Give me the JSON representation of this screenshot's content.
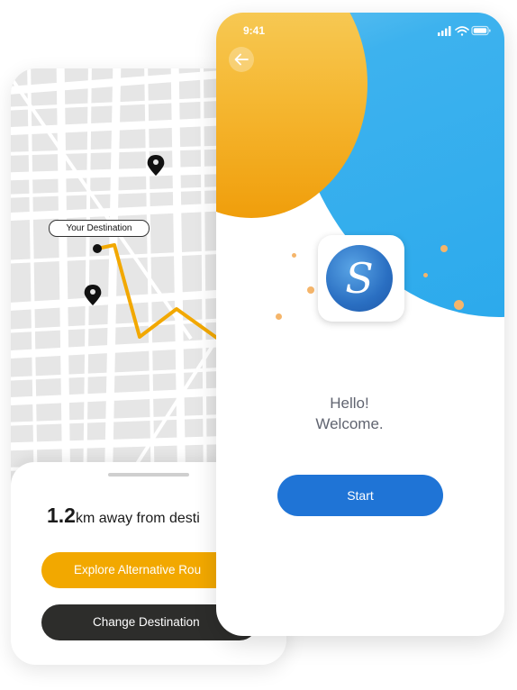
{
  "map_screen": {
    "destination_label": "Your Destination",
    "distance_value": "1.2",
    "distance_text": "km away from desti",
    "explore_button_label": "Explore Alternative Rou",
    "change_destination_label": "Change Destination",
    "route_color": "#f2a800",
    "pins": [
      "map-pin-icon",
      "map-pin-icon"
    ]
  },
  "welcome_screen": {
    "status_time": "9:41",
    "status_icons": [
      "signal-icon",
      "wifi-icon",
      "battery-icon"
    ],
    "back_icon": "arrow-left-icon",
    "app_logo_letter": "S",
    "greeting_line1": "Hello!",
    "greeting_line2": "Welcome.",
    "start_button_label": "Start",
    "accent_blue": "#1f74d6",
    "accent_orange": "#f5b833"
  }
}
